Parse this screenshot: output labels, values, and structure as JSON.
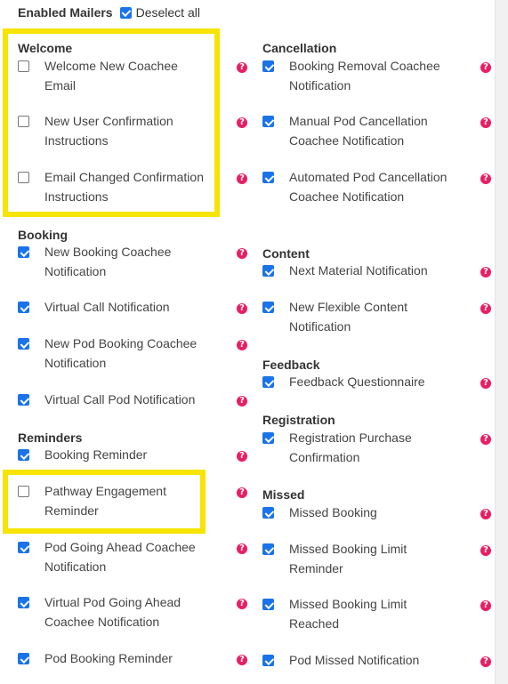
{
  "header": {
    "title": "Enabled Mailers",
    "deselect_label": "Deselect all",
    "deselect_checked": true
  },
  "help_glyph": "?",
  "colors": {
    "accent": "#1a73e8",
    "help": "#e91e63",
    "highlight": "#f7e400"
  },
  "left": {
    "welcome": {
      "title": "Welcome",
      "items": [
        {
          "label": "Welcome New Coachee Email",
          "checked": false
        },
        {
          "label": "New User Confirmation Instructions",
          "checked": false
        },
        {
          "label": "Email Changed Confirmation Instructions",
          "checked": false
        }
      ]
    },
    "booking": {
      "title": "Booking",
      "items": [
        {
          "label": "New Booking Coachee Notification",
          "checked": true
        },
        {
          "label": "Virtual Call Notification",
          "checked": true
        },
        {
          "label": "New Pod Booking Coachee Notification",
          "checked": true
        },
        {
          "label": "Virtual Call Pod Notification",
          "checked": true
        }
      ]
    },
    "reminders": {
      "title": "Reminders",
      "items": [
        {
          "label": "Booking Reminder",
          "checked": true
        },
        {
          "label": "Pathway Engagement Reminder",
          "checked": false
        },
        {
          "label": "Pod Going Ahead Coachee Notification",
          "checked": true
        },
        {
          "label": "Virtual Pod Going Ahead Coachee Notification",
          "checked": true
        },
        {
          "label": "Pod Booking Reminder",
          "checked": true
        }
      ]
    }
  },
  "right": {
    "cancellation": {
      "title": "Cancellation",
      "items": [
        {
          "label": "Booking Removal Coachee Notification",
          "checked": true
        },
        {
          "label": "Manual Pod Cancellation Coachee Notification",
          "checked": true
        },
        {
          "label": "Automated Pod Cancellation Coachee Notification",
          "checked": true
        }
      ]
    },
    "content": {
      "title": "Content",
      "items": [
        {
          "label": "Next Material Notification",
          "checked": true
        },
        {
          "label": "New Flexible Content Notification",
          "checked": true
        }
      ]
    },
    "feedback": {
      "title": "Feedback",
      "items": [
        {
          "label": "Feedback Questionnaire",
          "checked": true
        }
      ]
    },
    "registration": {
      "title": "Registration",
      "items": [
        {
          "label": "Registration Purchase Confirmation",
          "checked": true
        }
      ]
    },
    "missed": {
      "title": "Missed",
      "items": [
        {
          "label": "Missed Booking",
          "checked": true
        },
        {
          "label": "Missed Booking Limit Reminder",
          "checked": true
        },
        {
          "label": "Missed Booking Limit Reached",
          "checked": true
        },
        {
          "label": "Pod Missed Notification",
          "checked": true
        }
      ]
    }
  }
}
